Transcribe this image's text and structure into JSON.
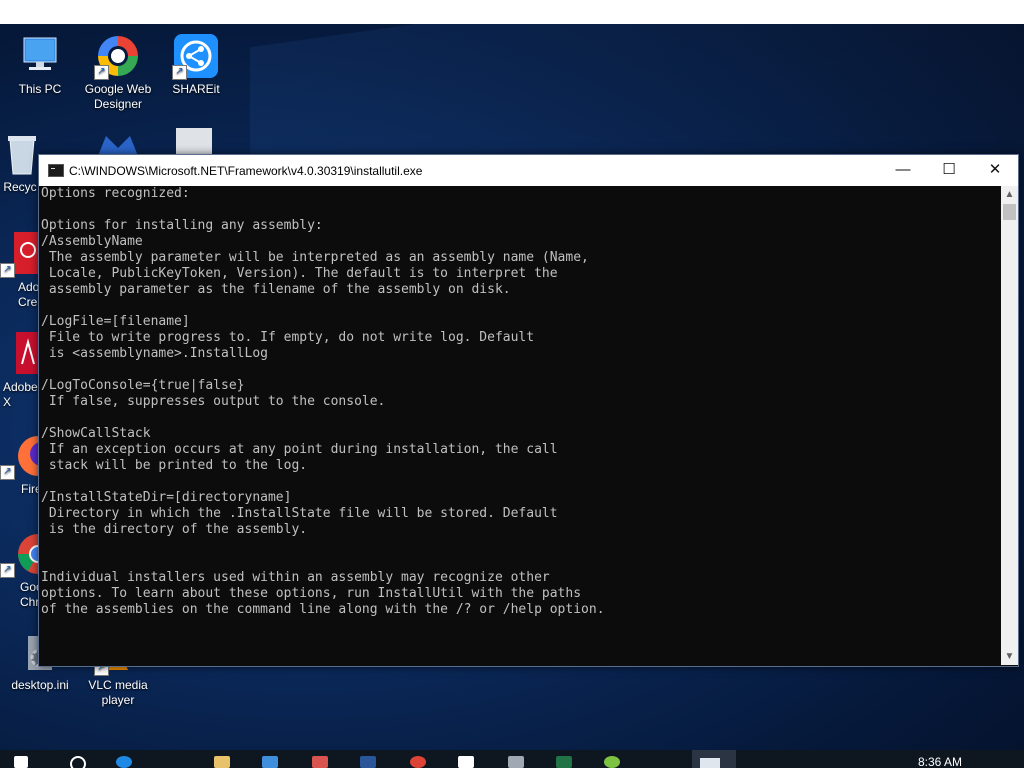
{
  "desktop": {
    "icons": [
      {
        "label": "This PC",
        "icon": "computer-icon"
      },
      {
        "label": "Google Web Designer",
        "icon": "google-web-designer-icon"
      },
      {
        "label": "SHAREit",
        "icon": "shareit-icon"
      },
      {
        "label": "Recyc",
        "icon": "recycle-bin-icon"
      },
      {
        "label": "Ado Crea",
        "icon": "adobe-creative-cloud-icon"
      },
      {
        "label": "Adobe X",
        "icon": "adobe-reader-icon"
      },
      {
        "label": "Fire",
        "icon": "firefox-icon"
      },
      {
        "label": "Goo Chr",
        "icon": "chrome-icon"
      },
      {
        "label": "desktop.ini",
        "icon": "gear-file-icon"
      },
      {
        "label": "VLC media player",
        "icon": "vlc-icon"
      }
    ]
  },
  "window": {
    "title": "C:\\WINDOWS\\Microsoft.NET\\Framework\\v4.0.30319\\installutil.exe",
    "minimize": "—",
    "maximize": "☐",
    "close": "✕"
  },
  "console": {
    "lines": [
      "Options recognized:",
      "",
      "Options for installing any assembly:",
      "/AssemblyName",
      " The assembly parameter will be interpreted as an assembly name (Name,",
      " Locale, PublicKeyToken, Version). The default is to interpret the",
      " assembly parameter as the filename of the assembly on disk.",
      "",
      "/LogFile=[filename]",
      " File to write progress to. If empty, do not write log. Default",
      " is <assemblyname>.InstallLog",
      "",
      "/LogToConsole={true|false}",
      " If false, suppresses output to the console.",
      "",
      "/ShowCallStack",
      " If an exception occurs at any point during installation, the call",
      " stack will be printed to the log.",
      "",
      "/InstallStateDir=[directoryname]",
      " Directory in which the .InstallState file will be stored. Default",
      " is the directory of the assembly.",
      "",
      "",
      "Individual installers used within an assembly may recognize other",
      "options. To learn about these options, run InstallUtil with the paths",
      "of the assemblies on the command line along with the /? or /help option."
    ]
  },
  "scrollbar": {
    "up": "▲",
    "down": "▼"
  },
  "taskbar": {
    "clock_time": "8:36 AM"
  }
}
